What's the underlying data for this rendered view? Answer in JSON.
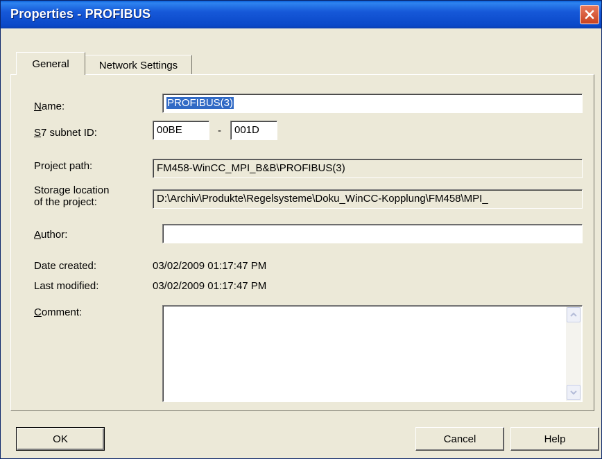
{
  "window": {
    "title": "Properties - PROFIBUS"
  },
  "tabs": [
    {
      "label": "General",
      "active": true
    },
    {
      "label": "Network Settings",
      "active": false
    }
  ],
  "form": {
    "name": {
      "label_hotkey": "N",
      "label_rest": "ame:",
      "value": "PROFIBUS(3)"
    },
    "subnet_id": {
      "label_hotkey": "S",
      "label_rest": "7 subnet ID:",
      "value1": "00BE",
      "separator": "-",
      "value2": "001D"
    },
    "project_path": {
      "label": "Project path:",
      "value": "FM458-WinCC_MPI_B&B\\PROFIBUS(3)"
    },
    "storage_location": {
      "label_line1": "Storage location",
      "label_line2": "of the project:",
      "value": "D:\\Archiv\\Produkte\\Regelsysteme\\Doku_WinCC-Kopplung\\FM458\\MPI_"
    },
    "author": {
      "label_hotkey": "A",
      "label_rest": "uthor:",
      "value": ""
    },
    "date_created": {
      "label": "Date created:",
      "value": "03/02/2009 01:17:47 PM"
    },
    "last_modified": {
      "label": "Last modified:",
      "value": "03/02/2009 01:17:47 PM"
    },
    "comment": {
      "label_hotkey": "C",
      "label_rest": "omment:",
      "value": ""
    }
  },
  "buttons": {
    "ok": "OK",
    "cancel": "Cancel",
    "help": "Help"
  },
  "colors": {
    "titlebar": "#0a48c8",
    "selection": "#316ac5",
    "dialog_bg": "#ece9d8"
  },
  "icons": {
    "close": "close-icon",
    "scroll_up": "scroll-up-arrow-icon",
    "scroll_down": "scroll-down-arrow-icon"
  }
}
